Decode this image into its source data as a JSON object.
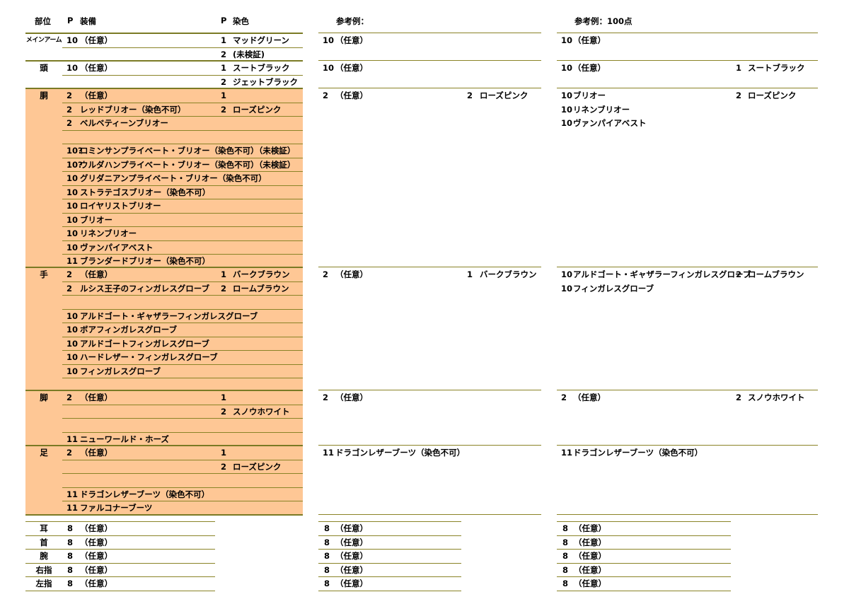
{
  "headers": {
    "slot": "部位",
    "p1": "P",
    "equip": "装備",
    "p2": "P",
    "dye": "染色",
    "ref1": "参考例：",
    "ref2": "参考例：100点"
  },
  "colors": {
    "highlight": "#fec795",
    "rule": "#8a8326"
  },
  "main": [
    {
      "slot": "メインアーム",
      "rows": [
        {
          "p": "10",
          "equip": "（任意）",
          "dp": "1",
          "dye": "マッドグリーン"
        },
        {
          "p": "",
          "equip": "",
          "dp": "2",
          "dye": "(未検証)"
        }
      ]
    },
    {
      "slot": "頭",
      "rows": [
        {
          "p": "10",
          "equip": "（任意）",
          "dp": "1",
          "dye": "スートブラック"
        },
        {
          "p": "",
          "equip": "",
          "dp": "2",
          "dye": "ジェットブラック"
        }
      ]
    },
    {
      "slot": "胴",
      "rows": [
        {
          "p": "2",
          "equip": "（任意）",
          "dp": "1",
          "dye": ""
        },
        {
          "p": "2",
          "equip": "レッドブリオー（染色不可）",
          "dp": "2",
          "dye": "ローズピンク"
        },
        {
          "p": "2",
          "equip": "ベルベティーンブリオー",
          "dp": "",
          "dye": ""
        },
        {
          "p": "",
          "equip": "",
          "dp": "",
          "dye": ""
        },
        {
          "p": "10?",
          "equip": "ロミンサンプライベート・ブリオー（染色不可）（未検証）",
          "dp": "",
          "dye": ""
        },
        {
          "p": "10?",
          "equip": "ウルダハンプライベート・ブリオー（染色不可）（未検証）",
          "dp": "",
          "dye": ""
        },
        {
          "p": "10",
          "equip": "グリダニアンプライベート・ブリオー（染色不可）",
          "dp": "",
          "dye": ""
        },
        {
          "p": "10",
          "equip": "ストラテゴスブリオー（染色不可）",
          "dp": "",
          "dye": ""
        },
        {
          "p": "10",
          "equip": "ロイヤリストブリオー",
          "dp": "",
          "dye": ""
        },
        {
          "p": "10",
          "equip": "ブリオー",
          "dp": "",
          "dye": ""
        },
        {
          "p": "10",
          "equip": "リネンブリオー",
          "dp": "",
          "dye": ""
        },
        {
          "p": "10",
          "equip": "ヴァンパイアベスト",
          "dp": "",
          "dye": ""
        },
        {
          "p": "11",
          "equip": "ブランダードブリオー（染色不可）",
          "dp": "",
          "dye": ""
        }
      ]
    },
    {
      "slot": "手",
      "rows": [
        {
          "p": "2",
          "equip": "（任意）",
          "dp": "1",
          "dye": "バークブラウン"
        },
        {
          "p": "2",
          "equip": "ルシス王子のフィンガレスグローブ",
          "dp": "2",
          "dye": "ロームブラウン"
        },
        {
          "p": "",
          "equip": "",
          "dp": "",
          "dye": ""
        },
        {
          "p": "10",
          "equip": "アルドゴート・ギャザラーフィンガレスグローブ",
          "dp": "",
          "dye": ""
        },
        {
          "p": "10",
          "equip": "ボアフィンガレスグローブ",
          "dp": "",
          "dye": ""
        },
        {
          "p": "10",
          "equip": "アルドゴートフィンガレスグローブ",
          "dp": "",
          "dye": ""
        },
        {
          "p": "10",
          "equip": "ハードレザー・フィンガレスグローブ",
          "dp": "",
          "dye": ""
        },
        {
          "p": "10",
          "equip": "フィンガレスグローブ",
          "dp": "",
          "dye": ""
        },
        {
          "p": "",
          "equip": "",
          "dp": "",
          "dye": ""
        }
      ]
    },
    {
      "slot": "脚",
      "rows": [
        {
          "p": "2",
          "equip": "（任意）",
          "dp": "1",
          "dye": ""
        },
        {
          "p": "",
          "equip": "",
          "dp": "2",
          "dye": "スノウホワイト"
        },
        {
          "p": "",
          "equip": "",
          "dp": "",
          "dye": ""
        },
        {
          "p": "11",
          "equip": "ニューワールド・ホーズ",
          "dp": "",
          "dye": ""
        }
      ]
    },
    {
      "slot": "足",
      "rows": [
        {
          "p": "2",
          "equip": "（任意）",
          "dp": "1",
          "dye": ""
        },
        {
          "p": "",
          "equip": "",
          "dp": "2",
          "dye": "ローズピンク"
        },
        {
          "p": "",
          "equip": "",
          "dp": "",
          "dye": ""
        },
        {
          "p": "11",
          "equip": "ドラゴンレザーブーツ（染色不可）",
          "dp": "",
          "dye": ""
        },
        {
          "p": "11",
          "equip": "ファルコナーブーツ",
          "dp": "",
          "dye": ""
        }
      ]
    }
  ],
  "ref1": [
    {
      "rows": [
        {
          "p": "10",
          "equip": "（任意）",
          "dp": "",
          "dye": ""
        }
      ]
    },
    {
      "rows": [
        {
          "p": "10",
          "equip": "（任意）",
          "dp": "",
          "dye": ""
        }
      ]
    },
    {
      "rows": [
        {
          "p": "2",
          "equip": "（任意）",
          "dp": "2",
          "dye": "ローズピンク"
        }
      ]
    },
    {
      "rows": [
        {
          "p": "2",
          "equip": "（任意）",
          "dp": "1",
          "dye": "バークブラウン"
        }
      ]
    },
    {
      "rows": [
        {
          "p": "2",
          "equip": "（任意）",
          "dp": "",
          "dye": ""
        }
      ]
    },
    {
      "rows": [
        {
          "p": "11",
          "equip": "ドラゴンレザーブーツ（染色不可）",
          "dp": "",
          "dye": ""
        }
      ]
    }
  ],
  "ref2": [
    {
      "rows": [
        {
          "p": "10",
          "equip": "（任意）",
          "dp": "",
          "dye": ""
        }
      ]
    },
    {
      "rows": [
        {
          "p": "10",
          "equip": "（任意）",
          "dp": "1",
          "dye": "スートブラック"
        }
      ]
    },
    {
      "rows": [
        {
          "p": "10",
          "equip": "ブリオー",
          "dp": "2",
          "dye": "ローズピンク"
        },
        {
          "p": "10",
          "equip": "リネンブリオー",
          "dp": "",
          "dye": ""
        },
        {
          "p": "10",
          "equip": "ヴァンパイアベスト",
          "dp": "",
          "dye": ""
        }
      ]
    },
    {
      "rows": [
        {
          "p": "10",
          "equip": "アルドゴート・ギャザラーフィンガレスグローブ",
          "dp": "2",
          "dye": "ロームブラウン"
        },
        {
          "p": "10",
          "equip": "フィンガレスグローブ",
          "dp": "",
          "dye": ""
        }
      ]
    },
    {
      "rows": [
        {
          "p": "2",
          "equip": "（任意）",
          "dp": "2",
          "dye": "スノウホワイト"
        }
      ]
    },
    {
      "rows": [
        {
          "p": "11",
          "equip": "ドラゴンレザーブーツ（染色不可）",
          "dp": "",
          "dye": ""
        }
      ]
    }
  ],
  "accessories": [
    {
      "slot": "耳",
      "p": "8",
      "equip": "（任意）"
    },
    {
      "slot": "首",
      "p": "8",
      "equip": "（任意）"
    },
    {
      "slot": "腕",
      "p": "8",
      "equip": "（任意）"
    },
    {
      "slot": "右指",
      "p": "8",
      "equip": "（任意）"
    },
    {
      "slot": "左指",
      "p": "8",
      "equip": "（任意）"
    }
  ]
}
